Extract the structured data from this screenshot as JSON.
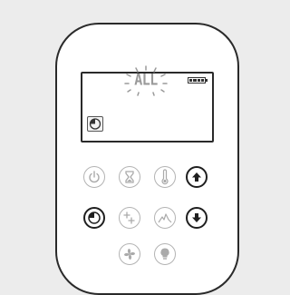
{
  "display": {
    "mode_text": "ALL",
    "battery_level": 1.0
  },
  "icons": {
    "power": "power-icon",
    "timer": "hourglass-icon",
    "temperature": "thermometer-icon",
    "up": "arrow-up-icon",
    "clock": "clock-icon",
    "split": "split-flow-icon",
    "flame": "flame-icon",
    "down": "arrow-down-icon",
    "fan": "fan-icon",
    "light": "lightbulb-icon"
  }
}
